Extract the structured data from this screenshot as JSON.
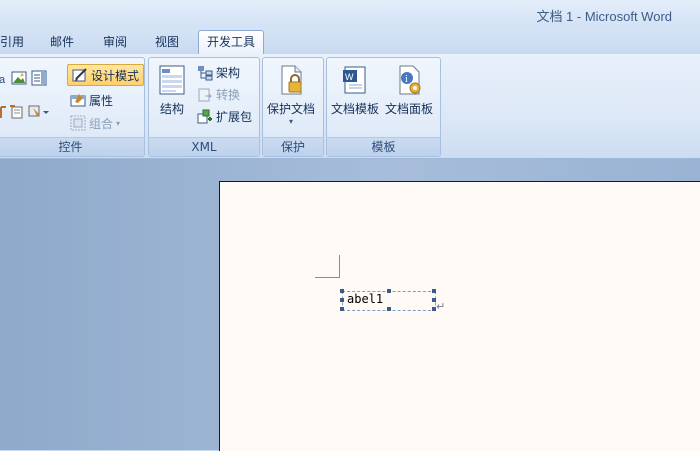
{
  "window": {
    "title": "文档 1 - Microsoft Word"
  },
  "tabs": [
    {
      "label": "引用"
    },
    {
      "label": "邮件"
    },
    {
      "label": "审阅"
    },
    {
      "label": "视图"
    },
    {
      "label": "开发工具",
      "active": true
    }
  ],
  "ribbon": {
    "controls": {
      "label": "控件",
      "design_mode": "设计模式",
      "properties": "属性",
      "group": "组合"
    },
    "xml": {
      "label": "XML",
      "structure": "结构",
      "schema": "架构",
      "transform": "转换",
      "expansion_pack": "扩展包"
    },
    "protect": {
      "label": "保护",
      "protect_document": "保护文档"
    },
    "templates": {
      "label": "模板",
      "document_template": "文档模板",
      "document_panel": "文档面板"
    }
  },
  "document": {
    "control_text": "abel1",
    "paragraph_mark": "↵"
  },
  "colors": {
    "ribbon": "#dce8f7",
    "highlight": "#ffcf6b",
    "page": "#fffaf6",
    "workspace": "#a7bdda"
  }
}
